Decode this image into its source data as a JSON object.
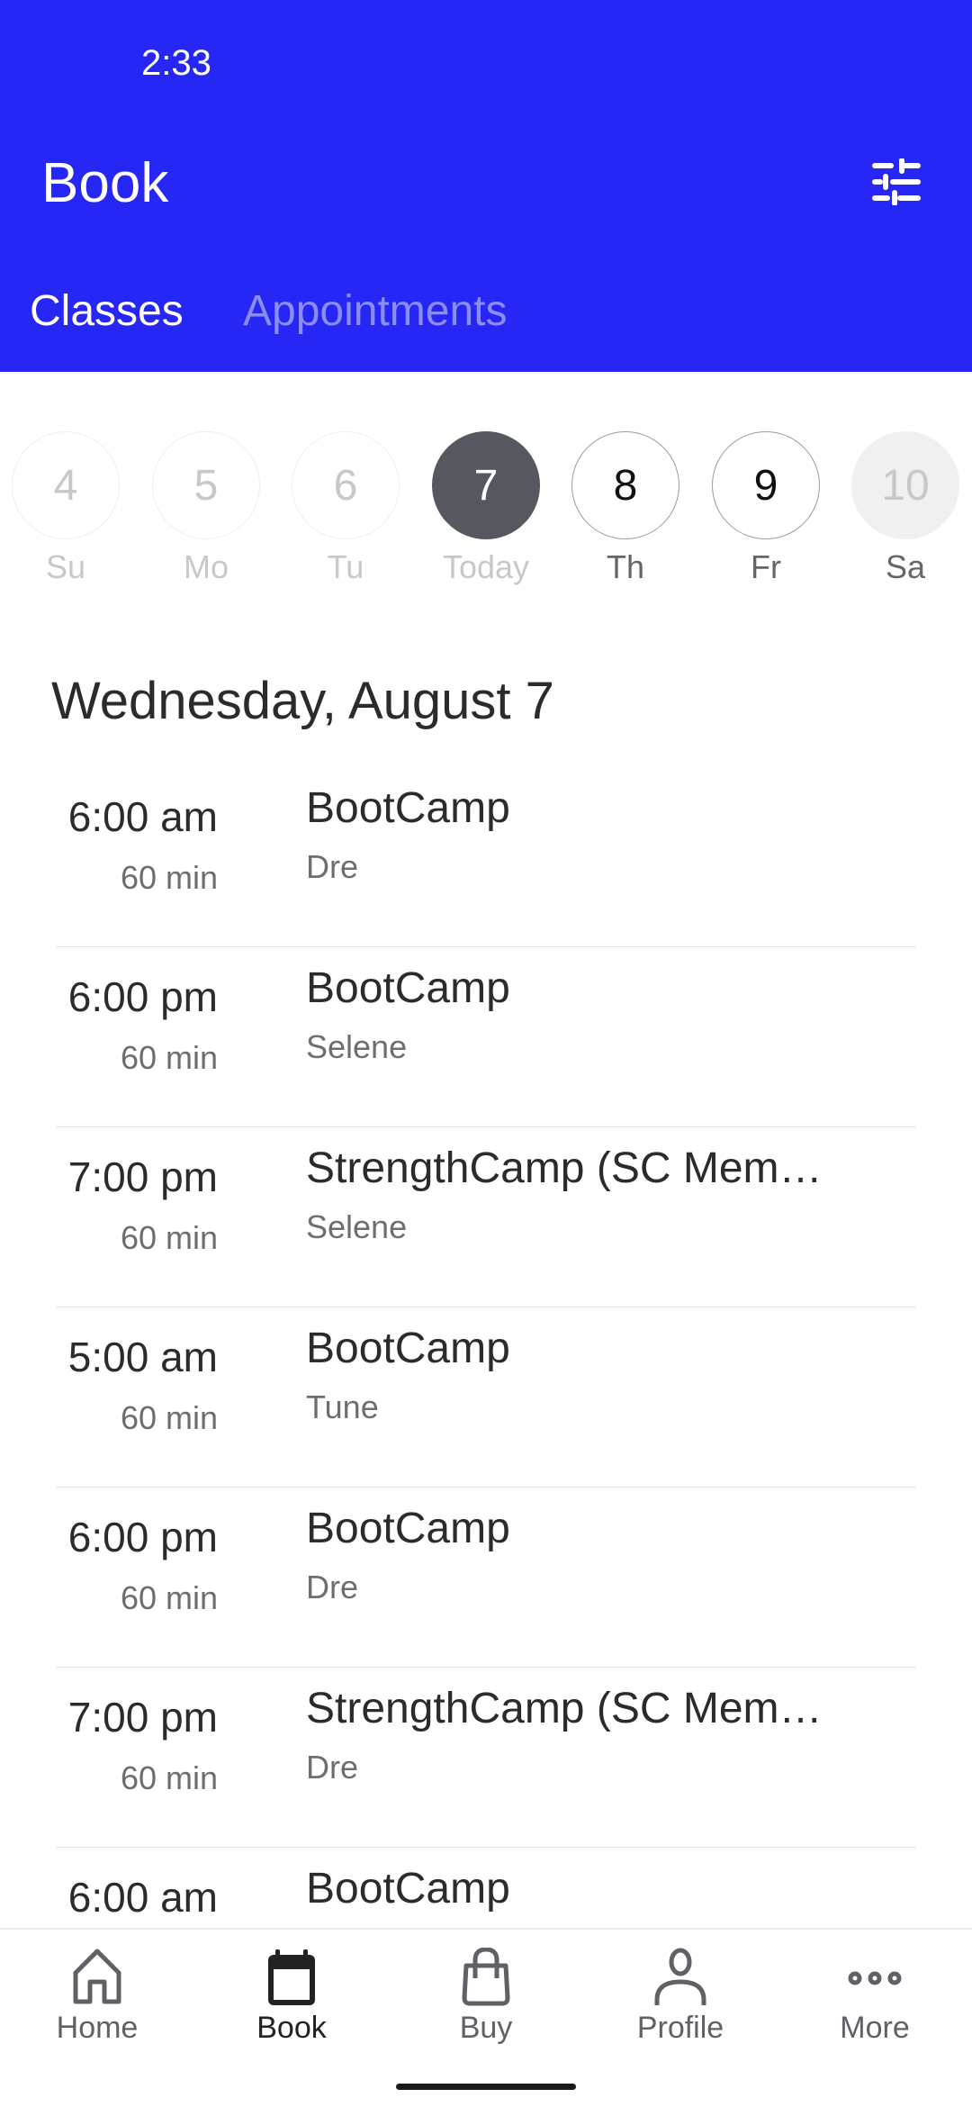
{
  "status_bar": {
    "time": "2:33"
  },
  "header": {
    "title": "Book",
    "filter_icon": "sliders-icon",
    "accent": "#2626f5"
  },
  "tabs": [
    {
      "label": "Classes",
      "active": true
    },
    {
      "label": "Appointments",
      "active": false
    }
  ],
  "days": [
    {
      "num": "4",
      "label": "Su",
      "state": "past"
    },
    {
      "num": "5",
      "label": "Mo",
      "state": "past"
    },
    {
      "num": "6",
      "label": "Tu",
      "state": "past"
    },
    {
      "num": "7",
      "label": "Today",
      "state": "selected"
    },
    {
      "num": "8",
      "label": "Th",
      "state": "future"
    },
    {
      "num": "9",
      "label": "Fr",
      "state": "future"
    },
    {
      "num": "10",
      "label": "Sa",
      "state": "disabled"
    }
  ],
  "date_heading": "Wednesday, August 7",
  "classes": [
    {
      "time": "6:00 am",
      "duration": "60 min",
      "name": "BootCamp",
      "instructor": "Dre"
    },
    {
      "time": "6:00 pm",
      "duration": "60 min",
      "name": "BootCamp",
      "instructor": "Selene"
    },
    {
      "time": "7:00 pm",
      "duration": "60 min",
      "name": "StrengthCamp (SC Mem…",
      "instructor": "Selene"
    },
    {
      "time": "5:00 am",
      "duration": "60 min",
      "name": "BootCamp",
      "instructor": "Tune"
    },
    {
      "time": "6:00 pm",
      "duration": "60 min",
      "name": "BootCamp",
      "instructor": "Dre"
    },
    {
      "time": "7:00 pm",
      "duration": "60 min",
      "name": "StrengthCamp (SC Mem…",
      "instructor": "Dre"
    },
    {
      "time": "6:00 am",
      "duration": "",
      "name": "BootCamp",
      "instructor": ""
    }
  ],
  "nav": [
    {
      "label": "Home",
      "icon": "home-icon"
    },
    {
      "label": "Book",
      "icon": "calendar-icon",
      "active": true
    },
    {
      "label": "Buy",
      "icon": "shopping-bag-icon"
    },
    {
      "label": "Profile",
      "icon": "person-icon"
    },
    {
      "label": "More",
      "icon": "more-dots-icon"
    }
  ]
}
